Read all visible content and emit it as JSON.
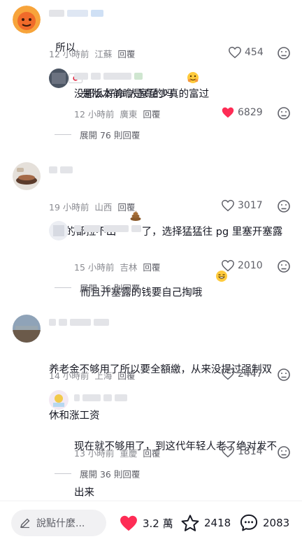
{
  "colors": {
    "liked_red": "#fe2c55",
    "text_primary": "#161823",
    "text_secondary": "#8a8b91"
  },
  "comments": [
    {
      "text": "所以",
      "flag_icon": "japan-flag-icon",
      "text_after_flag": "是版本前瞻是真的吗",
      "emoji_icon": "hugging-face-emoji",
      "time": "12 小時前",
      "location": "江蘇",
      "reply_label": "回覆",
      "likes": "454",
      "liked": false,
      "reply": {
        "text": "没那么好命 人家至少真的富过",
        "time": "12 小時前",
        "location": "廣東",
        "reply_label": "回覆",
        "likes": "6829",
        "liked": true
      },
      "expand_label": "展開 76 則回覆"
    },
    {
      "text": "饿的都拉不出",
      "emoji_icon": "poop-emoji",
      "text_after_emoji": "了，选择猛猛往 pg 里塞开塞露",
      "time": "19 小時前",
      "location": "山西",
      "reply_label": "回覆",
      "likes": "3017",
      "liked": false,
      "reply": {
        "text": "而且开塞露的钱要自己掏哦",
        "emoji_icon": "grinning-emoji",
        "time": "15 小時前",
        "location": "吉林",
        "reply_label": "回覆",
        "likes": "2010",
        "liked": false
      },
      "expand_label": "展開 36 則回覆"
    },
    {
      "text_line1": "养老金不够用了所以要全額繳，从来没提过强制双",
      "text_line2": "休和涨工资",
      "time": "14 小時前",
      "location": "上海",
      "reply_label": "回覆",
      "likes": "2447",
      "liked": false,
      "reply": {
        "text_line1": "现在就不够用了，到这代年轻人老了绝对发不",
        "text_line2": "出来",
        "time": "13 小時前",
        "location": "重慶",
        "reply_label": "回覆",
        "likes": "1814",
        "liked": false
      },
      "expand_label": "展開 36 則回覆"
    }
  ],
  "bottom_bar": {
    "input_placeholder": "說點什麼...",
    "likes": "3.2 萬",
    "favorites": "2418",
    "comments": "2083"
  }
}
